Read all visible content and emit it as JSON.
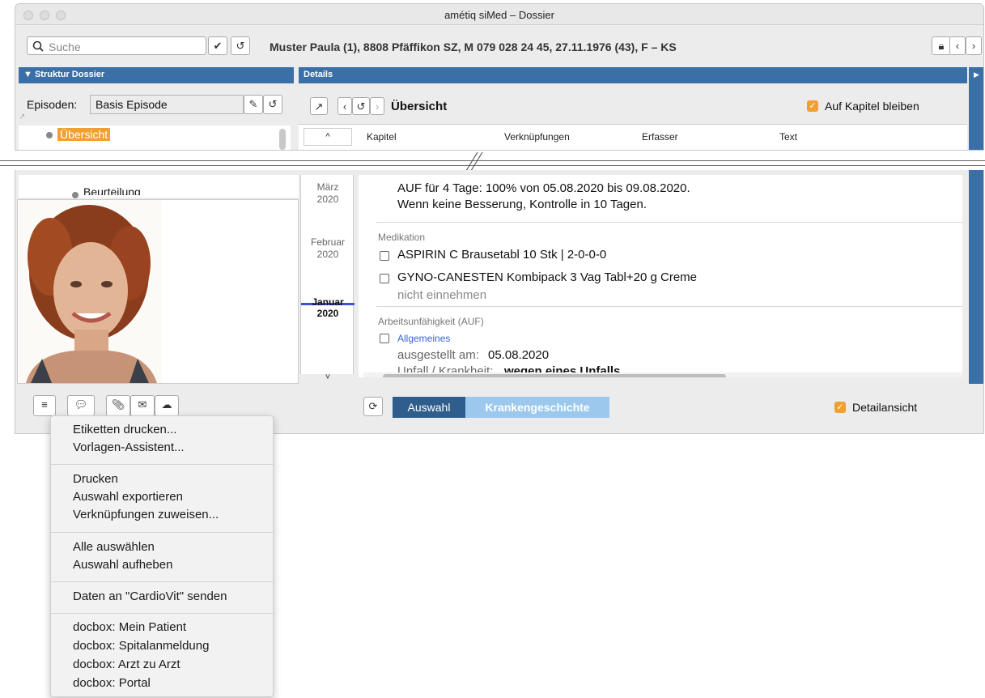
{
  "window": {
    "title": "amétiq siMed – Dossier"
  },
  "search": {
    "placeholder": "Suche"
  },
  "patient": {
    "header": "Muster Paula (1), 8808 Pfäffikon SZ, M 079 028 24 45, 27.11.1976 (43), F – KS"
  },
  "left": {
    "section_title": "Struktur Dossier",
    "episodes_label": "Episoden:",
    "episode_value": "Basis Episode",
    "tree_selected": "Übersicht",
    "tree_item_partial": "Beurteilung"
  },
  "details": {
    "section_title": "Details",
    "view_title": "Übersicht",
    "stay_on_chapter": "Auf Kapitel bleiben",
    "columns": [
      "Kapitel",
      "Verknüpfungen",
      "Erfasser",
      "Text"
    ]
  },
  "timeline": [
    {
      "month": "März",
      "year": "2020"
    },
    {
      "month": "Februar",
      "year": "2020"
    },
    {
      "month": "Januar",
      "year": "2020"
    }
  ],
  "content": {
    "line1": "AUF für 4 Tage: 100% von 05.08.2020 bis 09.08.2020.",
    "line2": "Wenn keine Besserung, Kontrolle in 10 Tagen.",
    "medication_label": "Medikation",
    "med1": "ASPIRIN C Brausetabl 10 Stk  |  2-0-0-0",
    "med2": "GYNO-CANESTEN Kombipack 3 Vag Tabl+20 g Creme",
    "med2_note": "nicht einnehmen",
    "auf_label": "Arbeitsunfähigkeit (AUF)",
    "auf_link": "Allgemeines",
    "issued_label": "ausgestellt am:",
    "issued_value": "05.08.2020",
    "partial_label": "Unfall / Krankheit:",
    "partial_value": "wegen eines Unfalls"
  },
  "bottom": {
    "selection_btn": "Auswahl",
    "history_btn": "Krankengeschichte",
    "detail_view": "Detailansicht"
  },
  "menu": {
    "groups": [
      [
        "Etiketten drucken...",
        "Vorlagen-Assistent..."
      ],
      [
        "Drucken",
        "Auswahl exportieren",
        "Verknüpfungen zuweisen..."
      ],
      [
        "Alle auswählen",
        "Auswahl aufheben"
      ],
      [
        "Daten an \"CardioVit\" senden"
      ],
      [
        "docbox: Mein Patient",
        "docbox: Spitalanmeldung",
        "docbox: Arzt zu Arzt",
        "docbox: Portal"
      ]
    ]
  },
  "colors": {
    "accent_blue": "#3a6fa8",
    "active_blue": "#2f5d8c",
    "light_blue": "#9cc8ee",
    "orange": "#f0a030",
    "link": "#3a63d8"
  }
}
